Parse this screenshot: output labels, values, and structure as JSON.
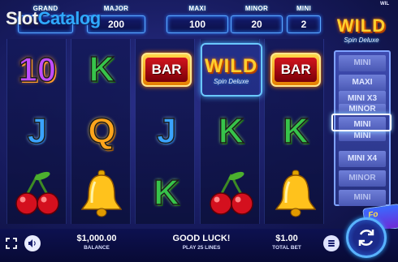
{
  "watermark": {
    "part1": "Slot",
    "part2": "Catalog"
  },
  "jackpots": {
    "grand": {
      "label": "GRAND",
      "value": ""
    },
    "major": {
      "label": "MAJOR",
      "value": "200"
    },
    "maxi": {
      "label": "MAXI",
      "value": "100"
    },
    "minor": {
      "label": "MINOR",
      "value": "20"
    },
    "mini": {
      "label": "MINI",
      "value": "2"
    }
  },
  "reels": {
    "row1": {
      "c1": "10",
      "c2": "K",
      "c3": "BAR",
      "c4": "WILD",
      "c5": "BAR"
    },
    "row2": {
      "c1": "J",
      "c2": "Q",
      "c3": "J",
      "c4": "K",
      "c5": "K"
    },
    "row3": {
      "c1": "cherries",
      "c2": "bell",
      "c3": "K",
      "c4": "cherries",
      "c5": "bell"
    },
    "wild_subtitle": "Spin Deluxe"
  },
  "side_panel": {
    "logo_word": "WILD",
    "logo_subtitle": "Spin Deluxe",
    "top_text": "WIL",
    "wheel_items": [
      "MINI",
      "MAXI",
      "MINI X3",
      "MINOR",
      "MINI",
      "MINI",
      "MINI X4",
      "MINOR",
      "MINI"
    ],
    "tag_text": "Fo"
  },
  "bottom": {
    "balance_value": "$1,000.00",
    "balance_label": "BALANCE",
    "message": "GOOD LUCK!",
    "lines_text": "PLAY 25 LINES",
    "bet_value": "$1.00",
    "bet_label": "TOTAL BET"
  },
  "icons": {
    "fullscreen": "fullscreen-icon",
    "sound": "speaker-icon",
    "bet": "coin-stack-icon",
    "spin": "spin-arrows-icon"
  },
  "colors": {
    "background": "#161a5c",
    "accent": "#59b2ff",
    "wild_gold": "#ffcf2e",
    "bar_red": "#d2141e"
  }
}
